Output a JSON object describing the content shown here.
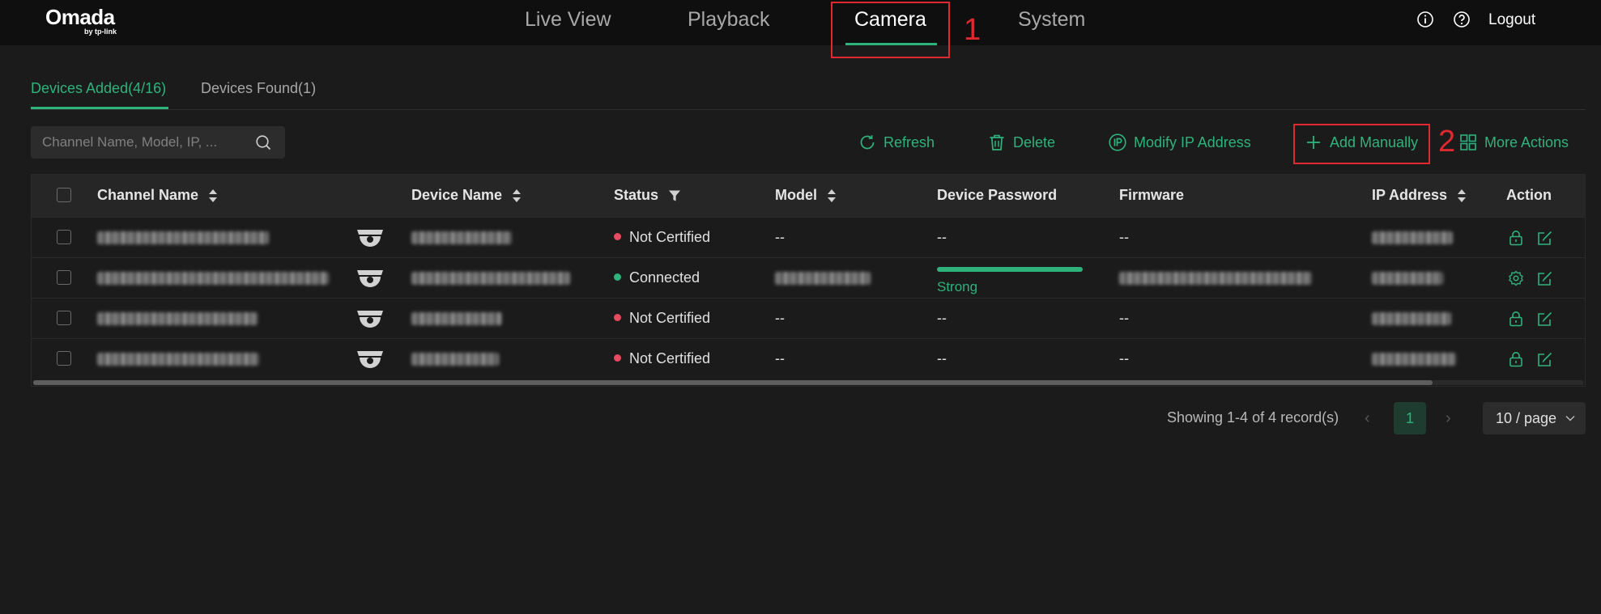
{
  "brand": {
    "name": "Omada",
    "sub": "by tp-link"
  },
  "nav": {
    "items": [
      {
        "label": "Live View"
      },
      {
        "label": "Playback"
      },
      {
        "label": "Camera"
      },
      {
        "label": "System"
      }
    ],
    "active": "Camera",
    "logout_label": "Logout"
  },
  "annotations": {
    "step1": "1",
    "step2": "2"
  },
  "subtabs": [
    {
      "label": "Devices Added(4/16)"
    },
    {
      "label": "Devices Found(1)"
    }
  ],
  "toolbar": {
    "search_placeholder": "Channel Name, Model, IP, ...",
    "refresh_label": "Refresh",
    "delete_label": "Delete",
    "modify_ip_label": "Modify IP Address",
    "add_manually_label": "Add Manually",
    "more_actions_label": "More Actions"
  },
  "table": {
    "columns": {
      "channel_name": "Channel Name",
      "device_name": "Device Name",
      "status": "Status",
      "model": "Model",
      "device_password": "Device Password",
      "firmware": "Firmware",
      "ip_address": "IP Address",
      "action": "Action"
    },
    "rows": [
      {
        "status": "Not Certified",
        "status_color": "#e84a5f",
        "model": "--",
        "password": "--",
        "firmware": "--",
        "action_icon": "lock-icon"
      },
      {
        "status": "Connected",
        "status_color": "#2fb37c",
        "password_strength": "Strong",
        "action_icon": "gear-icon"
      },
      {
        "status": "Not Certified",
        "status_color": "#e84a5f",
        "model": "--",
        "password": "--",
        "firmware": "--",
        "action_icon": "lock-icon"
      },
      {
        "status": "Not Certified",
        "status_color": "#e84a5f",
        "model": "--",
        "password": "--",
        "firmware": "--",
        "action_icon": "lock-icon"
      }
    ]
  },
  "pagination": {
    "summary": "Showing 1-4 of 4 record(s)",
    "current_page": "1",
    "page_size": "10 / page"
  },
  "colors": {
    "accent": "#2fb37c",
    "annotation": "#e0282e",
    "error": "#e84a5f"
  }
}
